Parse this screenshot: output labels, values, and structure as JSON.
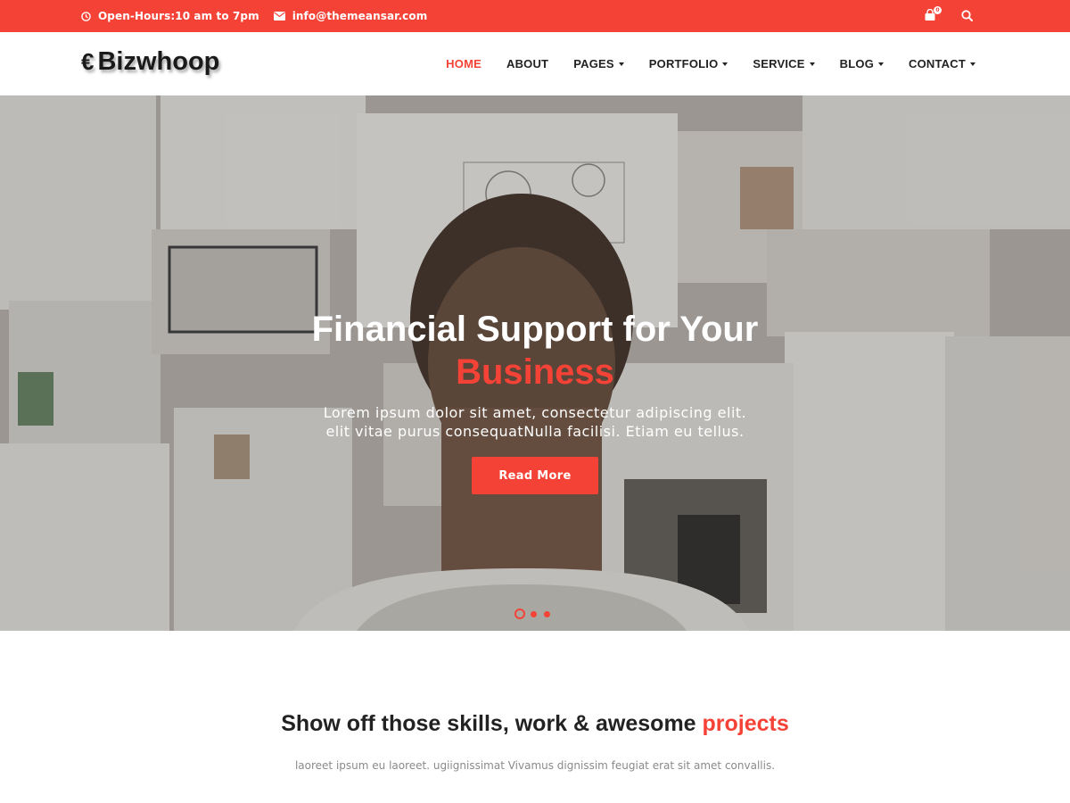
{
  "topbar": {
    "hours": "Open-Hours:10 am to 7pm",
    "email": "info@themeansar.com",
    "cart_count": "0",
    "bg_color": "#f44336"
  },
  "header": {
    "logo_mark": "€",
    "logo": "Bizwhoop",
    "nav": [
      {
        "label": "HOME"
      },
      {
        "label": "ABOUT"
      },
      {
        "label": "PAGES"
      },
      {
        "label": "PORTFOLIO"
      },
      {
        "label": "SERVICE"
      },
      {
        "label": "BLOG"
      },
      {
        "label": "CONTACT"
      }
    ]
  },
  "hero": {
    "title_line1": "Financial Support for Your",
    "title_accent": "Business",
    "text_line1": "Lorem ipsum dolor sit amet, consectetur adipiscing elit.",
    "text_line2": "elit vitae purus consequatNulla facilisi. Etiam eu tellus.",
    "button": "Read More",
    "slides": 3,
    "active_slide": 1
  },
  "section": {
    "title_main": "Show off those skills, work & awesome ",
    "title_accent": "projects",
    "text": "laoreet ipsum eu laoreet. ugiignissimat Vivamus dignissim feugiat erat sit amet convallis."
  },
  "colors": {
    "accent": "#f44336",
    "text_dark": "#222222"
  },
  "icons": {
    "clock": "clock-icon",
    "email": "envelope-icon",
    "cart": "shopping-bag-icon",
    "search": "search-icon"
  }
}
